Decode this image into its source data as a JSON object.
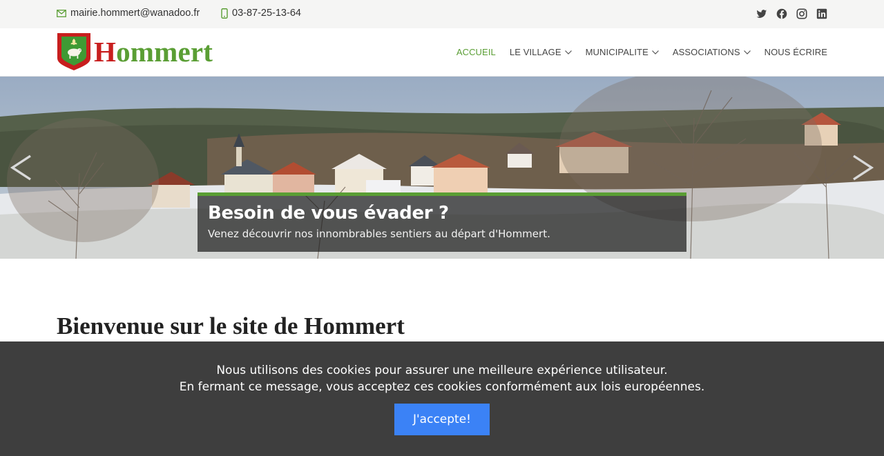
{
  "topbar": {
    "email": "mairie.hommert@wanadoo.fr",
    "phone": "03-87-25-13-64",
    "socials": [
      "twitter-icon",
      "facebook-icon",
      "instagram-icon",
      "linkedin-icon"
    ]
  },
  "header": {
    "logo": {
      "first_letter": "H",
      "rest": "ommert"
    },
    "nav": [
      {
        "label": "ACCUEIL",
        "active": true
      },
      {
        "label": "LE VILLAGE",
        "dropdown": true
      },
      {
        "label": "MUNICIPALITE",
        "dropdown": true
      },
      {
        "label": "ASSOCIATIONS",
        "dropdown": true
      },
      {
        "label": "NOUS ÉCRIRE"
      }
    ]
  },
  "hero": {
    "title": "Besoin de vous évader ?",
    "subtitle": "Venez découvrir nos innombrables sentiers au départ d'Hommert."
  },
  "main": {
    "welcome_title": "Bienvenue sur le site de Hommert"
  },
  "cookie": {
    "line1": "Nous utilisons des cookies pour assurer une meilleure expérience utilisateur.",
    "line2": "En fermant ce message, vous acceptez ces cookies conformément aux lois européennes.",
    "accept_label": "J'accepte!"
  },
  "colors": {
    "accent_green": "#5a9e34",
    "logo_red": "#c81e1e",
    "cookie_bg": "#3e3e3e",
    "button_blue": "#3b82f6"
  }
}
